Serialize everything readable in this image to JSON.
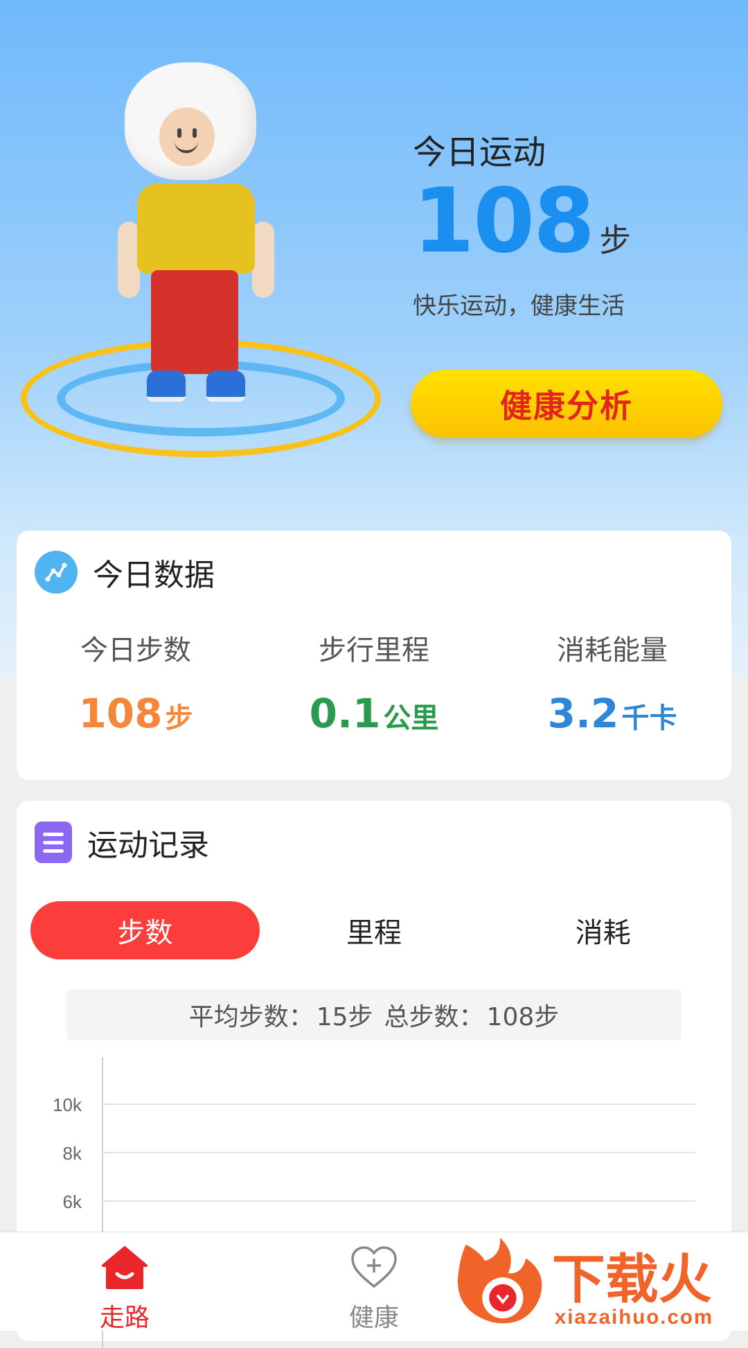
{
  "hero": {
    "title": "今日运动",
    "steps_value": "108",
    "steps_unit": "步",
    "slogan": "快乐运动，健康生活",
    "analysis_button": "健康分析"
  },
  "today": {
    "title": "今日数据",
    "stats": [
      {
        "label": "今日步数",
        "value": "108",
        "unit": "步",
        "color": "#f5873a"
      },
      {
        "label": "步行里程",
        "value": "0.1",
        "unit": "公里",
        "color": "#2a9a4f"
      },
      {
        "label": "消耗能量",
        "value": "3.2",
        "unit": "千卡",
        "color": "#2f86d6"
      }
    ]
  },
  "record": {
    "title": "运动记录",
    "tabs": [
      "步数",
      "里程",
      "消耗"
    ],
    "active_tab": 0,
    "summary_avg_label": "平均步数：",
    "summary_avg_value": "15步",
    "summary_total_label": "总步数：",
    "summary_total_value": "108步",
    "y_ticks": [
      "10k",
      "8k",
      "6k"
    ]
  },
  "bottom_nav": {
    "items": [
      {
        "label": "走路",
        "icon": "home-smile-icon",
        "active": true
      },
      {
        "label": "健康",
        "icon": "heart-plus-icon",
        "active": false
      }
    ],
    "active_color": "#e8262b",
    "inactive_color": "#888888"
  },
  "watermark": {
    "brand": "下载火",
    "url": "xiazaihuo.com"
  }
}
